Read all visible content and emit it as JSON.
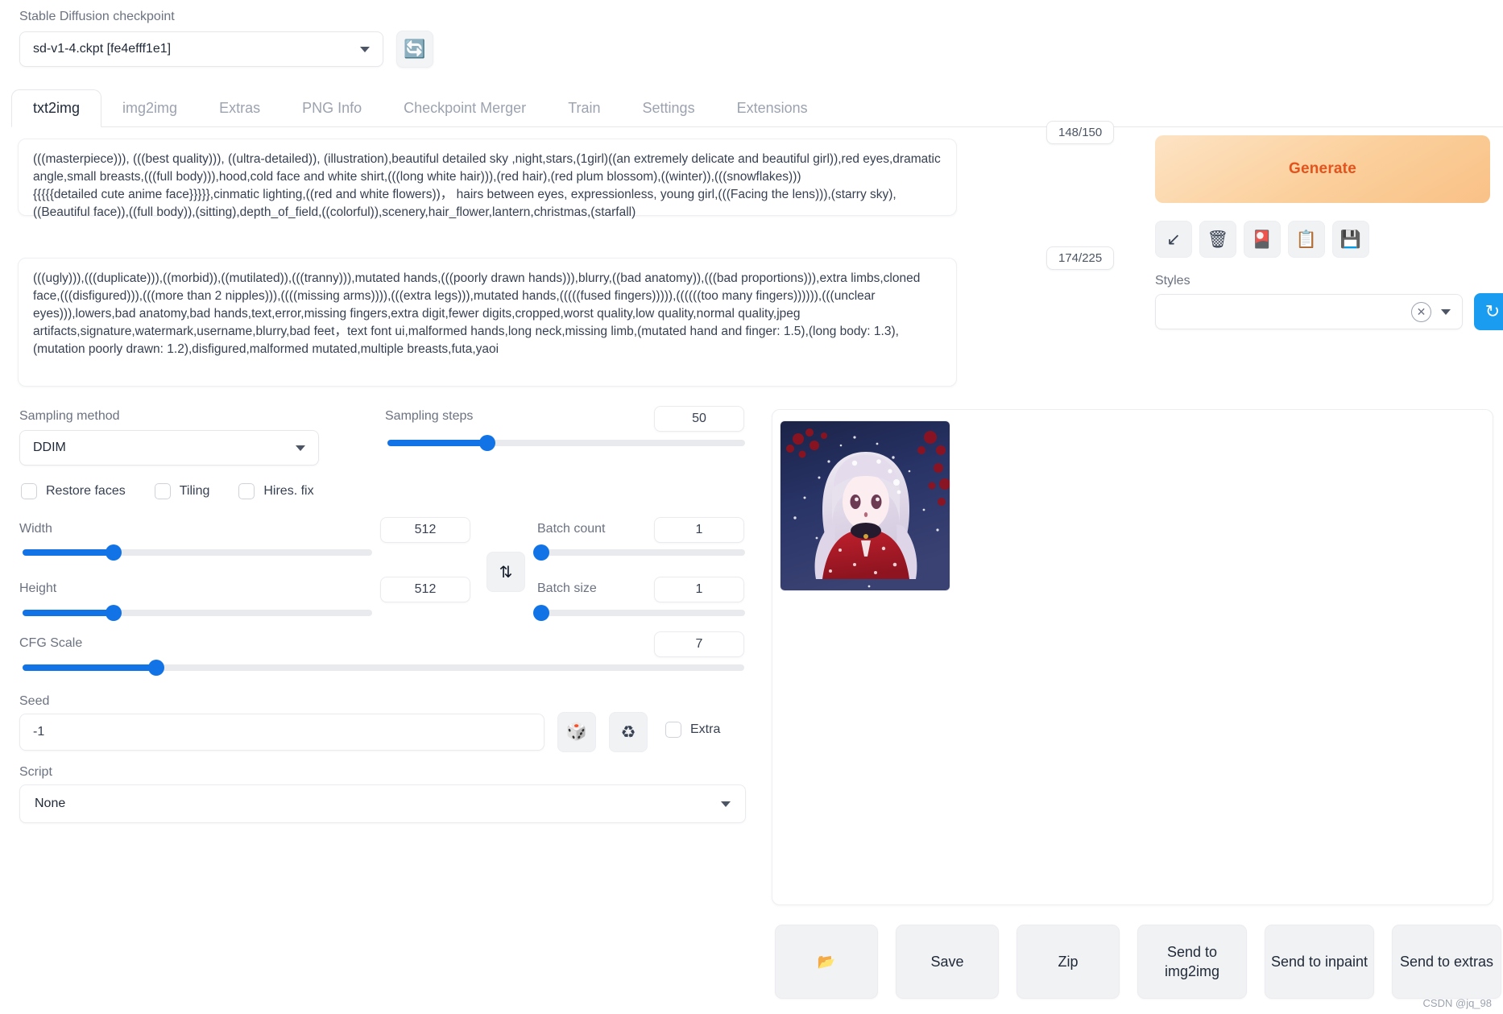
{
  "checkpoint": {
    "label": "Stable Diffusion checkpoint",
    "value": "sd-v1-4.ckpt [fe4efff1e1]",
    "refresh_icon": "refresh-icon"
  },
  "tabs": [
    {
      "label": "txt2img",
      "active": true
    },
    {
      "label": "img2img",
      "active": false
    },
    {
      "label": "Extras",
      "active": false
    },
    {
      "label": "PNG Info",
      "active": false
    },
    {
      "label": "Checkpoint Merger",
      "active": false
    },
    {
      "label": "Train",
      "active": false
    },
    {
      "label": "Settings",
      "active": false
    },
    {
      "label": "Extensions",
      "active": false
    }
  ],
  "prompt": {
    "positive": "(((masterpiece))), (((best quality))), ((ultra-detailed)), (illustration),beautiful detailed sky ,night,stars,(1girl)((an extremely delicate and beautiful girl)),red eyes,dramatic angle,small breasts,(((full body))),hood,cold face and white shirt,(((long white hair))),(red hair),(red plum blossom),((winter)),(((snowflakes)))\n{{{{{detailed cute anime face}}}}},cinmatic lighting,((red and white flowers))， hairs between eyes, expressionless, young girl,(((Facing the lens))),(starry sky),((Beautiful face)),((full body)),(sitting),depth_of_field,((colorful)),scenery,hair_flower,lantern,christmas,(starfall)",
    "positive_tokens": "148/150",
    "negative": "(((ugly))),(((duplicate))),((morbid)),((mutilated)),(((tranny))),mutated hands,(((poorly drawn hands))),blurry,((bad anatomy)),(((bad proportions))),extra limbs,cloned face,(((disfigured))),(((more than 2 nipples))),((((missing arms)))),(((extra legs))),mutated hands,(((((fused fingers))))),((((((too many fingers)))))),(((unclear eyes))),lowers,bad anatomy,bad hands,text,error,missing fingers,extra digit,fewer digits,cropped,worst quality,low quality,normal quality,jpeg artifacts,signature,watermark,username,blurry,bad feet，text font ui,malformed hands,long neck,missing limb,(mutated hand and finger: 1.5),(long body: 1.3),(mutation poorly drawn: 1.2),disfigured,malformed mutated,multiple breasts,futa,yaoi",
    "negative_tokens": "174/225"
  },
  "generate": {
    "label": "Generate",
    "tools": [
      {
        "name": "arrow-down-left-icon",
        "glyph": "↙"
      },
      {
        "name": "trash-icon",
        "glyph": "🗑"
      },
      {
        "name": "extra-networks-icon",
        "glyph": "🎴"
      },
      {
        "name": "clipboard-icon",
        "glyph": "📋"
      },
      {
        "name": "save-style-icon",
        "glyph": "💾"
      }
    ],
    "styles_label": "Styles",
    "styles_value": "",
    "styles_clear_icon": "close-icon",
    "styles_refresh_icon": "refresh-icon"
  },
  "settings": {
    "sampling_method_label": "Sampling method",
    "sampling_method_value": "DDIM",
    "sampling_steps_label": "Sampling steps",
    "sampling_steps_value": "50",
    "sampling_steps_pct": 28,
    "restore_faces_label": "Restore faces",
    "tiling_label": "Tiling",
    "hires_fix_label": "Hires. fix",
    "width_label": "Width",
    "width_value": "512",
    "width_pct": 26,
    "height_label": "Height",
    "height_value": "512",
    "height_pct": 26,
    "cfg_label": "CFG Scale",
    "cfg_value": "7",
    "cfg_pct": 18.5,
    "batch_count_label": "Batch count",
    "batch_count_value": "1",
    "batch_count_pct": 0,
    "batch_size_label": "Batch size",
    "batch_size_value": "1",
    "batch_size_pct": 0,
    "swap_icon": "swap-dimensions-icon",
    "seed_label": "Seed",
    "seed_value": "-1",
    "dice_icon": "dice-icon",
    "recycle_icon": "recycle-icon",
    "extra_label": "Extra",
    "script_label": "Script",
    "script_value": "None"
  },
  "gallery": {
    "image_alt": "generated-anime-girl-winter-red-coat"
  },
  "actions": [
    {
      "name": "open-folder-button",
      "label": "",
      "icon": "folder-icon",
      "glyph": "📂"
    },
    {
      "name": "save-button",
      "label": "Save",
      "icon": "",
      "glyph": ""
    },
    {
      "name": "zip-button",
      "label": "Zip",
      "icon": "",
      "glyph": ""
    },
    {
      "name": "send-to-img2img-button",
      "label": "Send to img2img",
      "icon": "",
      "glyph": ""
    },
    {
      "name": "send-to-inpaint-button",
      "label": "Send to inpaint",
      "icon": "",
      "glyph": ""
    },
    {
      "name": "send-to-extras-button",
      "label": "Send to extras",
      "icon": "",
      "glyph": ""
    }
  ],
  "watermark": "CSDN @jq_98",
  "colors": {
    "accent_blue": "#1273e6",
    "generate_orange": "#e2531d",
    "refresh_blue": "#1a9cf0"
  }
}
